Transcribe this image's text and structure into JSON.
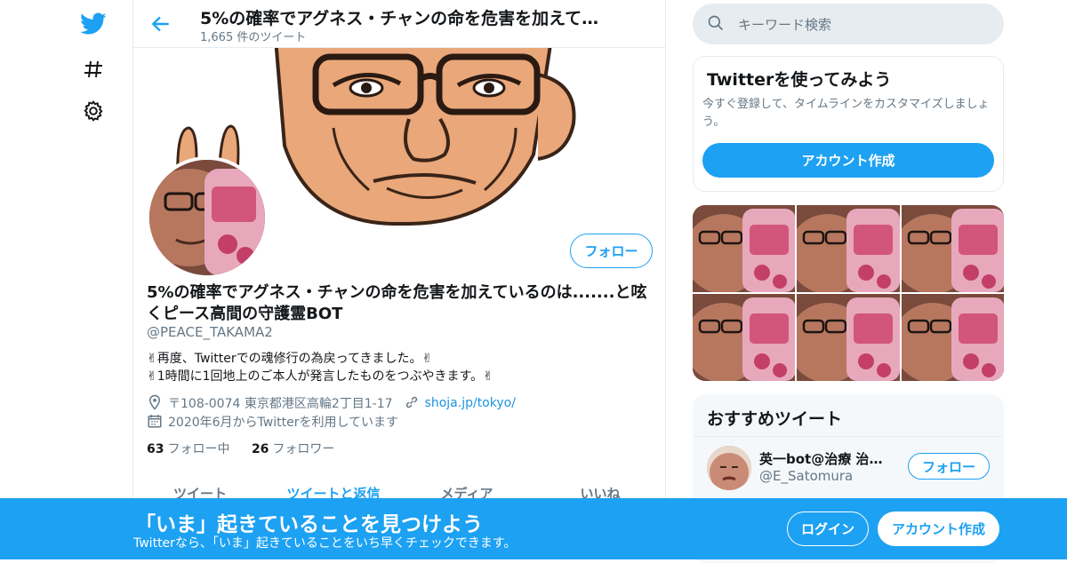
{
  "header": {
    "title": "5%の確率でアグネス・チャンの命を危害を加えて…",
    "tweet_count": "1,665 件のツイート"
  },
  "profile": {
    "follow_label": "フォロー",
    "display_name": "5%の確率でアグネス・チャンの命を危害を加えているのは.......と呟くピース高間の守護霊BOT",
    "handle": "@PEACE_TAKAMA2",
    "bio_line1": "✌再度、Twitterでの魂修行の為戻ってきました。✌",
    "bio_line2": "✌1時間に1回地上のご本人が発言したものをつぶやきます。✌",
    "location": "〒108-0074 東京都港区高輪2丁目1-17",
    "url": "shoja.jp/tokyo/",
    "joined": "2020年6月からTwitterを利用しています",
    "following_count": "63",
    "following_label": "フォロー中",
    "followers_count": "26",
    "followers_label": "フォロワー"
  },
  "tabs": [
    "ツイート",
    "ツイートと返信",
    "メディア",
    "いいね"
  ],
  "active_tab": 1,
  "search": {
    "placeholder": "キーワード検索"
  },
  "signup_card": {
    "title": "Twitterを使ってみよう",
    "description": "今すぐ登録して、タイムラインをカスタマイズしましょう。",
    "button": "アカウント作成"
  },
  "recommended": {
    "title": "おすすめツイート",
    "items": [
      {
        "name": "英一bot@治療 治療 …",
        "handle": "@E_Satomura",
        "follow_label": "フォロー"
      }
    ]
  },
  "bottom_bar": {
    "title": "「いま」起きていることを見つけよう",
    "subtitle": "Twitterなら、「いま」起きていることをいち早くチェックできます。",
    "login": "ログイン",
    "signup": "アカウント作成"
  },
  "icons": [
    "twitter-bird-icon",
    "hashtag-icon",
    "gear-icon",
    "back-arrow-icon",
    "search-icon",
    "location-icon",
    "link-icon",
    "calendar-icon"
  ],
  "colors": {
    "accent": "#1da1f2",
    "text": "#14171a",
    "muted": "#657786",
    "border": "#e6ecf0"
  }
}
